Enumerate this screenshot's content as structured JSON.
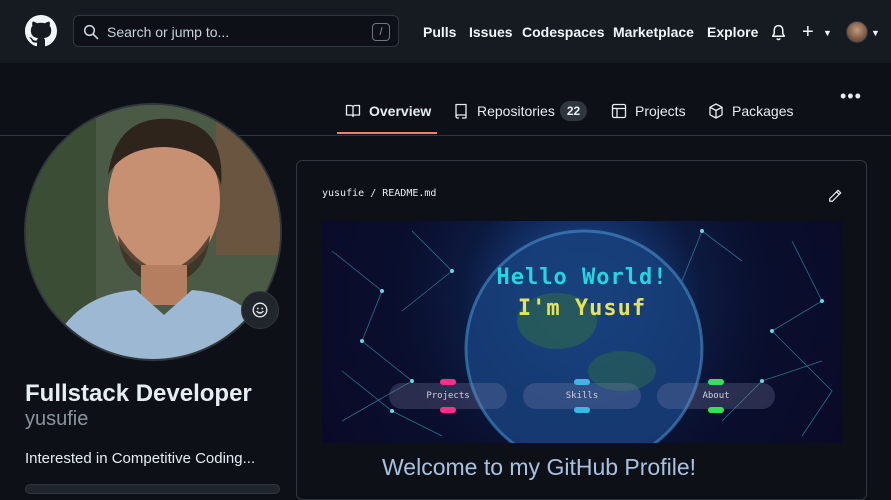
{
  "header": {
    "search_placeholder": "Search or jump to...",
    "search_shortcut": "/",
    "nav": [
      "Pulls",
      "Issues",
      "Codespaces",
      "Marketplace",
      "Explore"
    ]
  },
  "tabs": {
    "overview": "Overview",
    "repositories": "Repositories",
    "repositories_count": "22",
    "projects": "Projects",
    "packages": "Packages"
  },
  "profile": {
    "name": "Fullstack Developer",
    "login": "yusufie",
    "bio": "Interested in Competitive Coding..."
  },
  "readme": {
    "owner": "yusufie",
    "separator": "/",
    "file": "README.md",
    "banner_line1": "Hello World!",
    "banner_line2": "I'm Yusuf",
    "buttons": [
      "Projects",
      "Skills",
      "About"
    ],
    "welcome": "Welcome to my GitHub Profile!"
  },
  "colors": {
    "accent_tab": "#f78166",
    "banner_cyan": "#23d7e0",
    "banner_yellow": "#e8e25a"
  }
}
